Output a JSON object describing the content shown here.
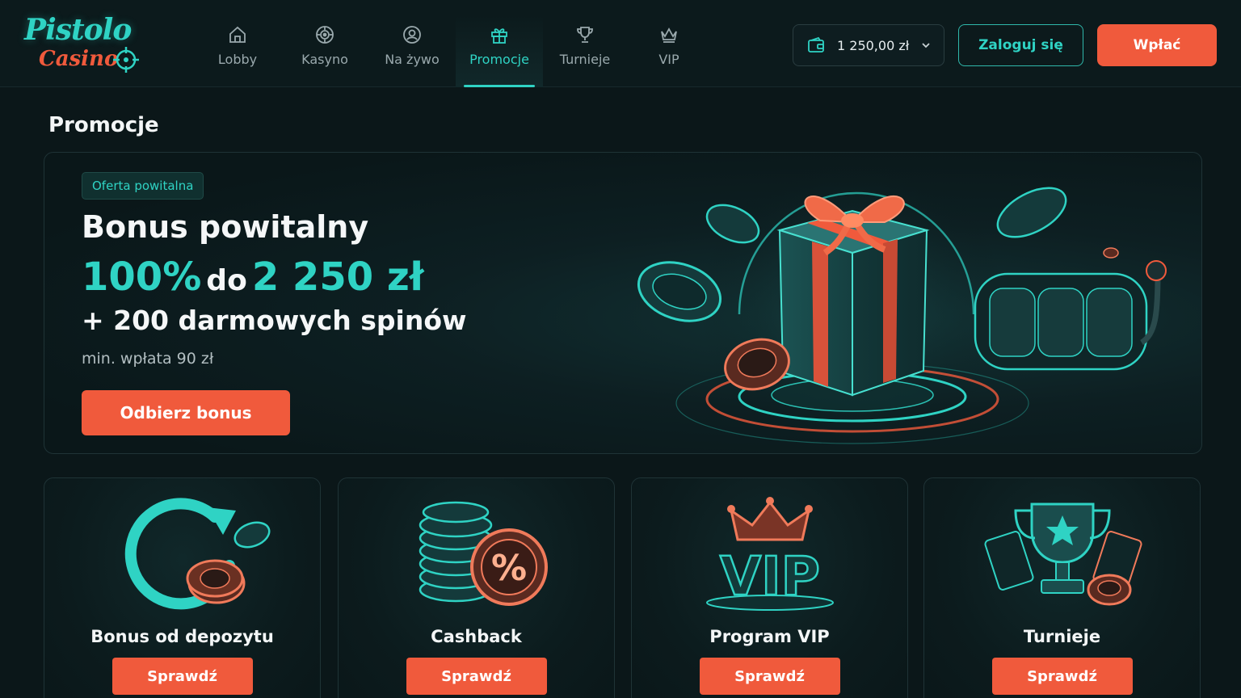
{
  "brand": {
    "line1": "Pistolo",
    "line2": "Casino"
  },
  "nav": [
    {
      "label": "Lobby",
      "icon": "home-icon"
    },
    {
      "label": "Kasyno",
      "icon": "roulette-icon"
    },
    {
      "label": "Na żywo",
      "icon": "live-dealer-icon"
    },
    {
      "label": "Promocje",
      "icon": "gift-icon",
      "active": true
    },
    {
      "label": "Turnieje",
      "icon": "trophy-icon"
    },
    {
      "label": "VIP",
      "icon": "crown-icon"
    }
  ],
  "header": {
    "balance": "1 250,00 zł",
    "login_label": "Zaloguj się",
    "deposit_label": "Wpłać"
  },
  "page": {
    "title": "Promocje"
  },
  "hero": {
    "badge": "Oferta powitalna",
    "title": "Bonus powitalny",
    "percent": "100%",
    "upto": "do",
    "amount": "2 250 zł",
    "spins": "+ 200 darmowych spinów",
    "min_deposit": "min. wpłata 90 zł",
    "cta": "Odbierz bonus"
  },
  "cards": [
    {
      "title": "Bonus od depozytu",
      "button": "Sprawdź",
      "icon": "refresh-chips-icon"
    },
    {
      "title": "Cashback",
      "button": "Sprawdź",
      "icon": "percent-chips-icon"
    },
    {
      "title": "Program VIP",
      "button": "Sprawdź",
      "icon": "vip-crown-icon"
    },
    {
      "title": "Turnieje",
      "button": "Sprawdź",
      "icon": "trophy-cards-icon"
    }
  ],
  "colors": {
    "accent": "#2fd3c4",
    "primary": "#f05a3c",
    "background": "#0b1719"
  }
}
